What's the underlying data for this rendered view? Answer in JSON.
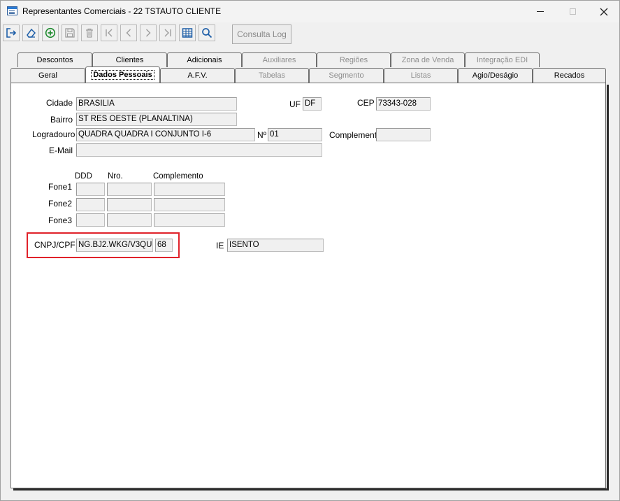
{
  "window": {
    "title": "Representantes Comerciais - 22 TSTAUTO CLIENTE",
    "controls": [
      "minimize",
      "maximize",
      "close"
    ]
  },
  "toolbar": {
    "buttons": [
      {
        "name": "exit",
        "icon": "exit-icon",
        "enabled": true
      },
      {
        "name": "clear",
        "icon": "eraser-icon",
        "enabled": true
      },
      {
        "name": "add",
        "icon": "add-circle-icon",
        "enabled": true
      },
      {
        "name": "save",
        "icon": "floppy-icon",
        "enabled": false
      },
      {
        "name": "delete",
        "icon": "trash-icon",
        "enabled": false
      },
      {
        "name": "first",
        "icon": "first-record-icon",
        "enabled": false
      },
      {
        "name": "previous",
        "icon": "previous-icon",
        "enabled": false
      },
      {
        "name": "next",
        "icon": "next-icon",
        "enabled": false
      },
      {
        "name": "last",
        "icon": "last-record-icon",
        "enabled": false
      },
      {
        "name": "grid",
        "icon": "table-grid-icon",
        "enabled": true
      },
      {
        "name": "search",
        "icon": "search-icon",
        "enabled": true
      }
    ],
    "consulta_log": "Consulta Log"
  },
  "tabs_row1": [
    {
      "label": "Descontos",
      "enabled": true
    },
    {
      "label": "Clientes",
      "enabled": true
    },
    {
      "label": "Adicionais",
      "enabled": true
    },
    {
      "label": "Auxiliares",
      "enabled": false
    },
    {
      "label": "Regiões",
      "enabled": false
    },
    {
      "label": "Zona de Venda",
      "enabled": false
    },
    {
      "label": "Integração EDI",
      "enabled": false
    }
  ],
  "tabs_row2": [
    {
      "label": "Geral",
      "enabled": true
    },
    {
      "label": "Dados Pessoais",
      "enabled": true,
      "active": true
    },
    {
      "label": "A.F.V.",
      "enabled": true
    },
    {
      "label": "Tabelas",
      "enabled": false
    },
    {
      "label": "Segmento",
      "enabled": false
    },
    {
      "label": "Listas",
      "enabled": false
    },
    {
      "label": "Agio/Deságio",
      "enabled": true
    },
    {
      "label": "Recados",
      "enabled": true
    }
  ],
  "form": {
    "cidade_label": "Cidade",
    "cidade": "BRASILIA",
    "uf_label": "UF",
    "uf": "DF",
    "cep_label": "CEP",
    "cep": "73343-028",
    "bairro_label": "Bairro",
    "bairro": "ST RES OESTE (PLANALTINA)",
    "logradouro_label": "Logradouro",
    "logradouro": "QUADRA QUADRA I CONJUNTO I-6",
    "numero_label": "Nº",
    "numero": "01",
    "complemento_label": "Complemento",
    "complemento": "",
    "email_label": "E-Mail",
    "email": "",
    "phones_header": {
      "ddd": "DDD",
      "nro": "Nro.",
      "complemento": "Complemento"
    },
    "phones": [
      {
        "label": "Fone1",
        "ddd": "",
        "nro": "",
        "complemento": ""
      },
      {
        "label": "Fone2",
        "ddd": "",
        "nro": "",
        "complemento": ""
      },
      {
        "label": "Fone3",
        "ddd": "",
        "nro": "",
        "complemento": ""
      }
    ],
    "cnpj_label": "CNPJ/CPF",
    "cnpj": "NG.BJ2.WKG/V3QU",
    "cnpj_dv": "68",
    "ie_label": "IE",
    "ie": "ISENTO"
  },
  "colors": {
    "highlight": "#e0222a",
    "panel_bg": "#ffffff",
    "field_bg": "#f0f0f0",
    "accent_blue": "#2b7bd3",
    "add_green": "#1e8a2e"
  }
}
